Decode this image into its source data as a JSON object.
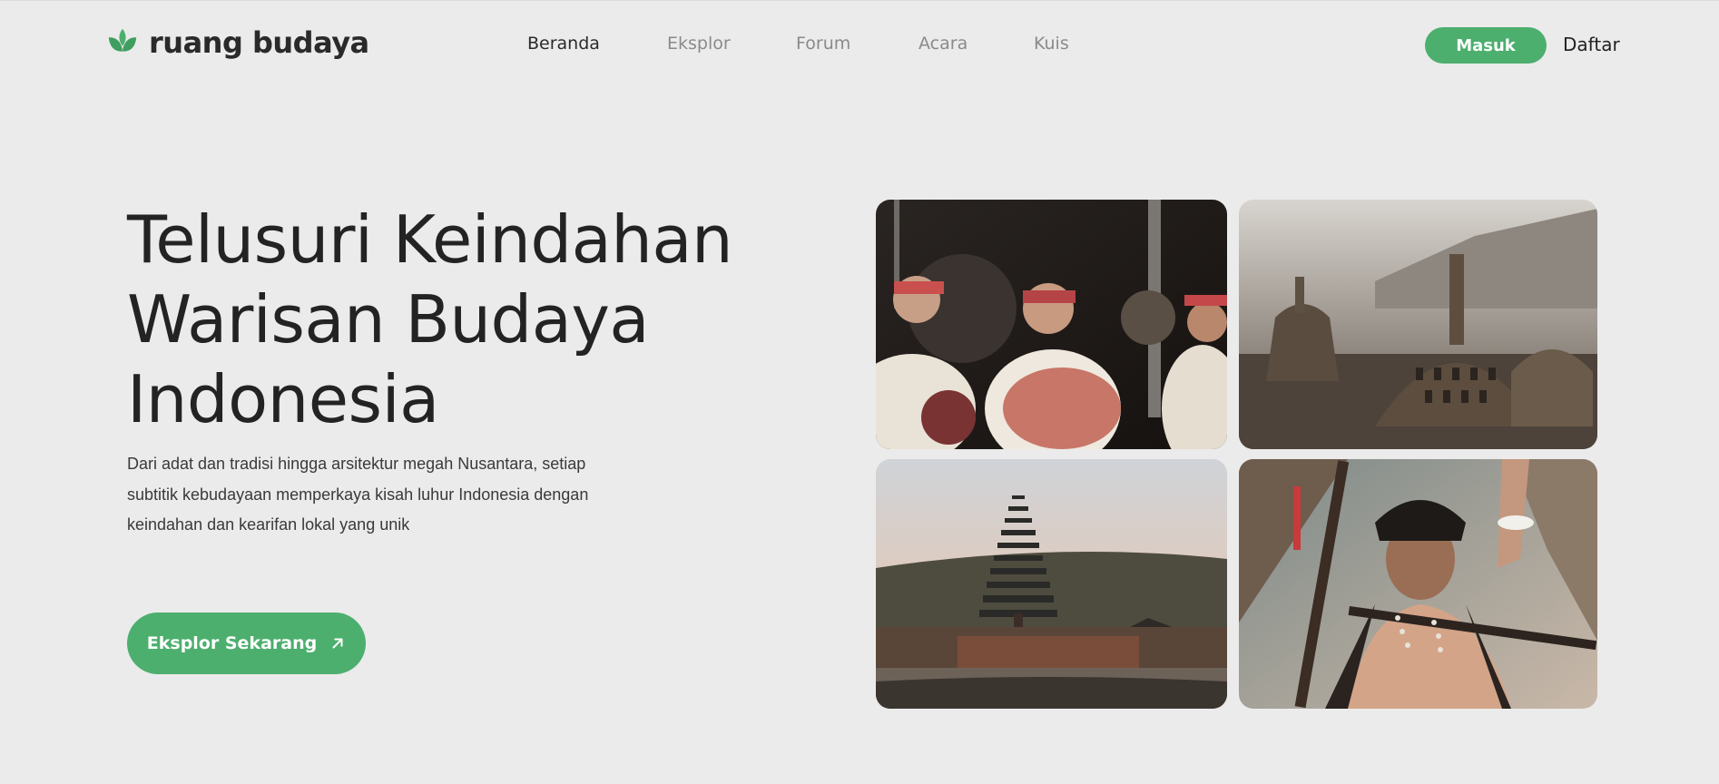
{
  "brand": {
    "name": "ruang budaya",
    "accent_color": "#4caf6e",
    "logo_icon": "lotus-leaf-icon"
  },
  "nav": {
    "items": [
      {
        "label": "Beranda",
        "active": true
      },
      {
        "label": "Eksplor",
        "active": false
      },
      {
        "label": "Forum",
        "active": false
      },
      {
        "label": "Acara",
        "active": false
      },
      {
        "label": "Kuis",
        "active": false
      }
    ]
  },
  "auth": {
    "login_label": "Masuk",
    "register_label": "Daftar"
  },
  "hero": {
    "title_lines": [
      "Telusuri Keindahan",
      "Warisan Budaya",
      "Indonesia"
    ],
    "description": "Dari adat dan tradisi hingga arsitektur megah Nusantara, setiap subtitik kebudayaan memperkaya kisah luhur Indonesia dengan keindahan dan kearifan lokal yang unik",
    "cta_label": "Eksplor Sekarang",
    "cta_icon": "arrow-up-right-icon"
  },
  "gallery": [
    {
      "subject": "gamelan-musicians"
    },
    {
      "subject": "borobudur-stupas"
    },
    {
      "subject": "ulun-danu-temple"
    },
    {
      "subject": "traditional-warrior"
    }
  ]
}
